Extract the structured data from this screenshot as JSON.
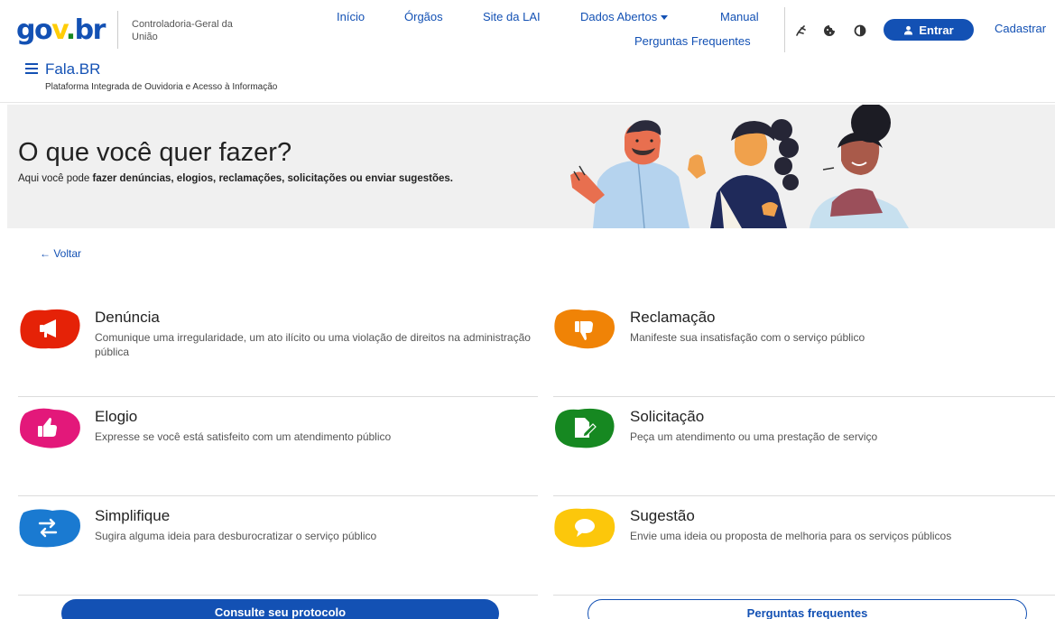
{
  "header": {
    "logo": {
      "part1": "go",
      "part2": "v",
      "part3": ".",
      "part4": "br"
    },
    "org_name": "Controladoria-Geral da União",
    "nav": {
      "inicio": "Início",
      "orgaos": "Órgãos",
      "site_lai": "Site da LAI",
      "dados_abertos": "Dados Abertos",
      "manual": "Manual",
      "perguntas": "Perguntas Frequentes"
    },
    "entrar_label": "Entrar",
    "cadastrar_label": "Cadastrar",
    "icons": [
      "libras-icon",
      "cookie-icon",
      "contrast-icon",
      "user-icon"
    ]
  },
  "app": {
    "title": "Fala.BR",
    "subtitle": "Plataforma Integrada de Ouvidoria e Acesso à Informação"
  },
  "hero": {
    "title": "O que você quer fazer?",
    "text_prefix": "Aqui você pode ",
    "text_bold": "fazer denúncias, elogios, reclamações, solicitações ou enviar sugestões."
  },
  "back_label": "← Voltar",
  "services": [
    {
      "title": "Denúncia",
      "desc": "Comunique uma irregularidade, um ato ilícito ou uma violação de direitos na administração pública",
      "color": "#e52207",
      "icon": "megaphone-icon"
    },
    {
      "title": "Reclamação",
      "desc": "Manifeste sua insatisfação com o serviço público",
      "color": "#f08306",
      "icon": "thumbs-down-icon"
    },
    {
      "title": "Elogio",
      "desc": "Expresse se você está satisfeito com um atendimento público",
      "color": "#e3187a",
      "icon": "thumbs-up-icon"
    },
    {
      "title": "Solicitação",
      "desc": "Peça um atendimento ou uma prestação de serviço",
      "color": "#168821",
      "icon": "document-edit-icon"
    },
    {
      "title": "Simplifique",
      "desc": "Sugira alguma ideia para desburocratizar o serviço público",
      "color": "#1a7ad1",
      "icon": "exchange-arrows-icon"
    },
    {
      "title": "Sugestão",
      "desc": "Envie uma ideia ou proposta de melhoria para os serviços públicos",
      "color": "#fcc70b",
      "icon": "speech-bubble-icon"
    }
  ],
  "buttons": {
    "protocolo": "Consulte seu protocolo",
    "faq": "Perguntas frequentes"
  },
  "colors": {
    "primary": "#1351b4",
    "hero_bg": "#f0f0f0"
  }
}
